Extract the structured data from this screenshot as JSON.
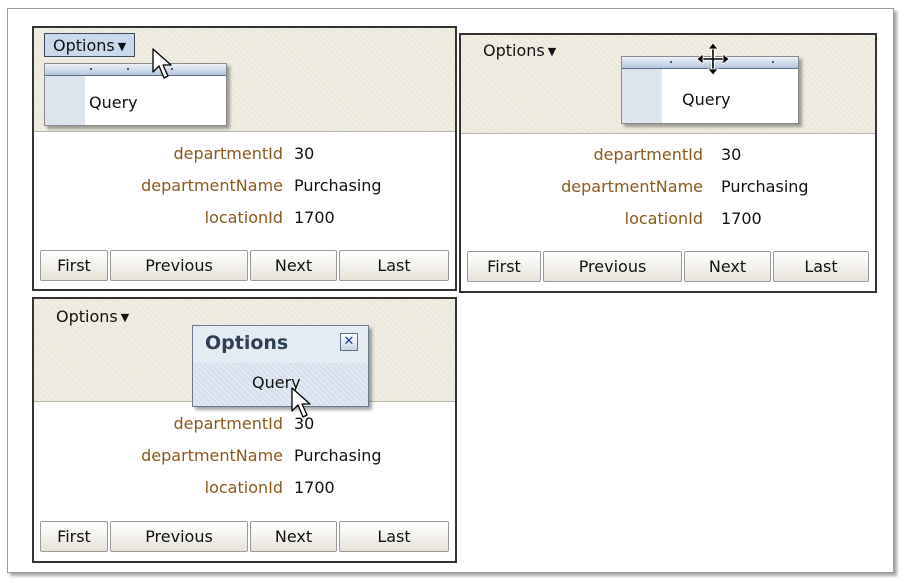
{
  "panels": [
    {
      "options_label": "Options",
      "menu_item": "Query",
      "fields": [
        {
          "label": "departmentId",
          "value": "30"
        },
        {
          "label": "departmentName",
          "value": "Purchasing"
        },
        {
          "label": "locationId",
          "value": "1700"
        }
      ],
      "buttons": [
        "First",
        "Previous",
        "Next",
        "Last"
      ]
    },
    {
      "options_label": "Options",
      "menu_item": "Query",
      "fields": [
        {
          "label": "departmentId",
          "value": "30"
        },
        {
          "label": "departmentName",
          "value": "Purchasing"
        },
        {
          "label": "locationId",
          "value": "1700"
        }
      ],
      "buttons": [
        "First",
        "Previous",
        "Next",
        "Last"
      ]
    },
    {
      "options_label": "Options",
      "dialog_title": "Options",
      "menu_item": "Query",
      "fields": [
        {
          "label": "departmentId",
          "value": "30"
        },
        {
          "label": "departmentName",
          "value": "Purchasing"
        },
        {
          "label": "locationId",
          "value": "1700"
        }
      ],
      "buttons": [
        "First",
        "Previous",
        "Next",
        "Last"
      ]
    }
  ],
  "icons": {
    "caret": "caret-down-icon",
    "close": "close-icon",
    "cursor": "arrow-cursor-icon",
    "move": "move-cursor-icon"
  },
  "colors": {
    "label": "#8a5a1a",
    "header": "#ece9dc",
    "menu_active": "#c9d9ee",
    "dialog_title": "#2f3f56"
  }
}
